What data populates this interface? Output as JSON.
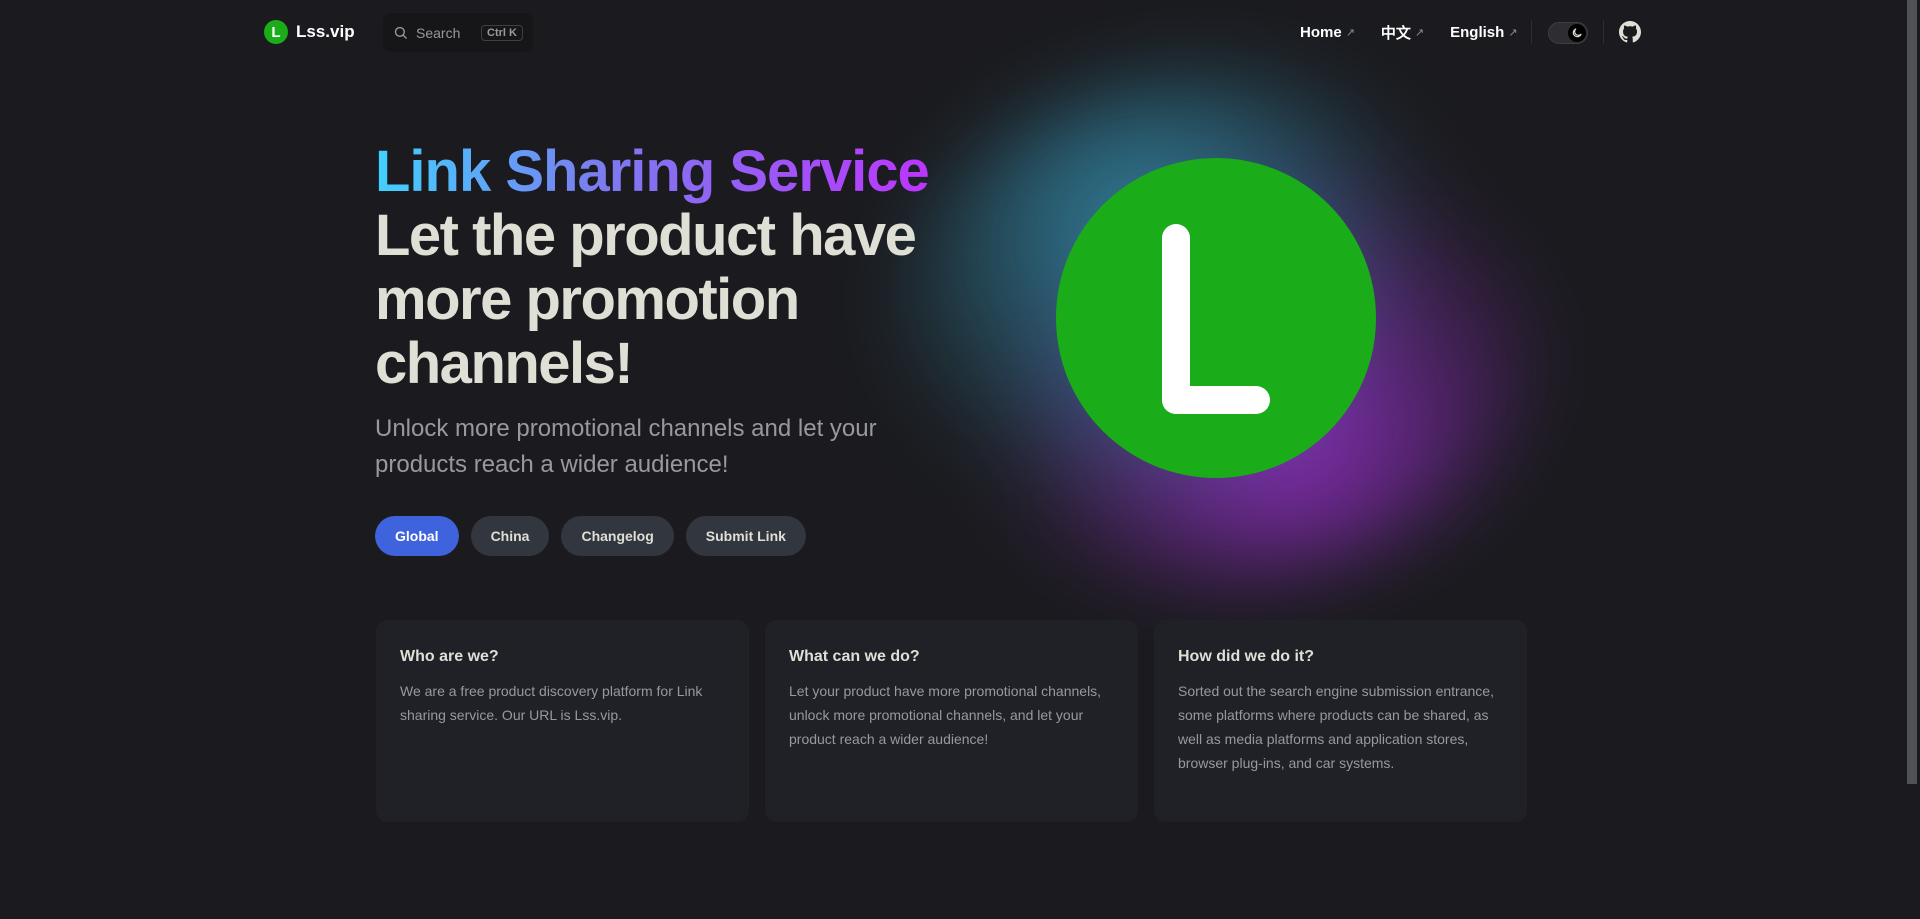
{
  "nav": {
    "brand": {
      "logo_letter": "L",
      "name": "Lss.vip"
    },
    "search": {
      "label": "Search",
      "shortcut": "Ctrl K"
    },
    "links": [
      {
        "label": "Home",
        "external": "↗"
      },
      {
        "label": "中文",
        "external": "↗"
      },
      {
        "label": "English",
        "external": "↗"
      }
    ],
    "theme": "dark"
  },
  "hero": {
    "name": "Link Sharing Service",
    "text": "Let the product have more promotion channels!",
    "tagline": "Unlock more promotional channels and let your products reach a wider audience!",
    "logo_letter": "L",
    "actions": [
      {
        "label": "Global",
        "theme": "brand"
      },
      {
        "label": "China",
        "theme": "alt"
      },
      {
        "label": "Changelog",
        "theme": "alt"
      },
      {
        "label": "Submit Link",
        "theme": "alt"
      }
    ]
  },
  "features": [
    {
      "title": "Who are we?",
      "details": "We are a free product discovery platform for Link sharing service. Our URL is Lss.vip."
    },
    {
      "title": "What can we do?",
      "details": "Let your product have more promotional channels, unlock more promotional channels, and let your product reach a wider audience!"
    },
    {
      "title": "How did we do it?",
      "details": "Sorted out the search engine submission entrance, some platforms where products can be shared, as well as media platforms and application stores, browser plug-ins, and car systems."
    }
  ],
  "colors": {
    "background": "#1b1b1f",
    "brand": "#3e63dd",
    "logo_green": "#1aad19",
    "gradient_start": "#41d1ff",
    "gradient_end": "#bd34fe"
  }
}
